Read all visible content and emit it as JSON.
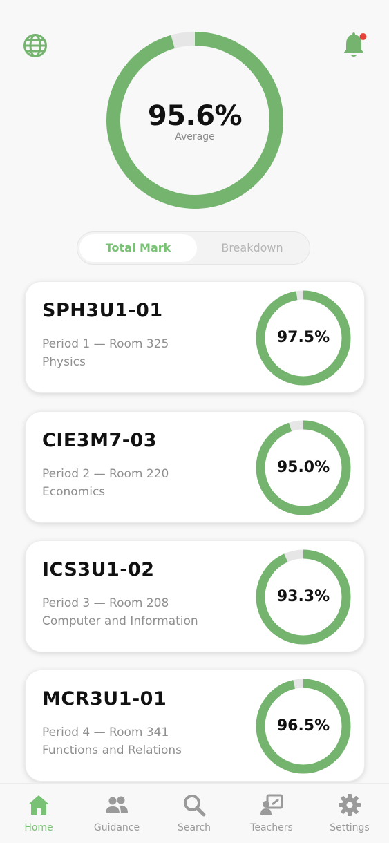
{
  "colors": {
    "accent": "#79c174",
    "ring_green": "#74b46e",
    "ring_track": "#e6e6e6",
    "notification": "#e8413a"
  },
  "header": {
    "left_icon": "globe-icon",
    "right_icon": "bell-icon"
  },
  "average": {
    "value": "95.6%",
    "label": "Average",
    "percent": 95.6
  },
  "tabs": [
    {
      "label": "Total Mark",
      "active": true
    },
    {
      "label": "Breakdown",
      "active": false
    }
  ],
  "courses": [
    {
      "code": "SPH3U1-01",
      "period": "Period 1 — Room 325",
      "name": "Physics",
      "mark": "97.5%",
      "percent": 97.5
    },
    {
      "code": "CIE3M7-03",
      "period": "Period 2 — Room 220",
      "name": "Economics",
      "mark": "95.0%",
      "percent": 95.0
    },
    {
      "code": "ICS3U1-02",
      "period": "Period 3 — Room 208",
      "name": "Computer and Information",
      "mark": "93.3%",
      "percent": 93.3
    },
    {
      "code": "MCR3U1-01",
      "period": "Period 4  — Room 341",
      "name": "Functions and Relations",
      "mark": "96.5%",
      "percent": 96.5
    }
  ],
  "nav": [
    {
      "label": "Home",
      "icon": "home-icon",
      "active": true
    },
    {
      "label": "Guidance",
      "icon": "people-icon",
      "active": false
    },
    {
      "label": "Search",
      "icon": "search-icon",
      "active": false
    },
    {
      "label": "Teachers",
      "icon": "teacher-icon",
      "active": false
    },
    {
      "label": "Settings",
      "icon": "gear-icon",
      "active": false
    }
  ]
}
